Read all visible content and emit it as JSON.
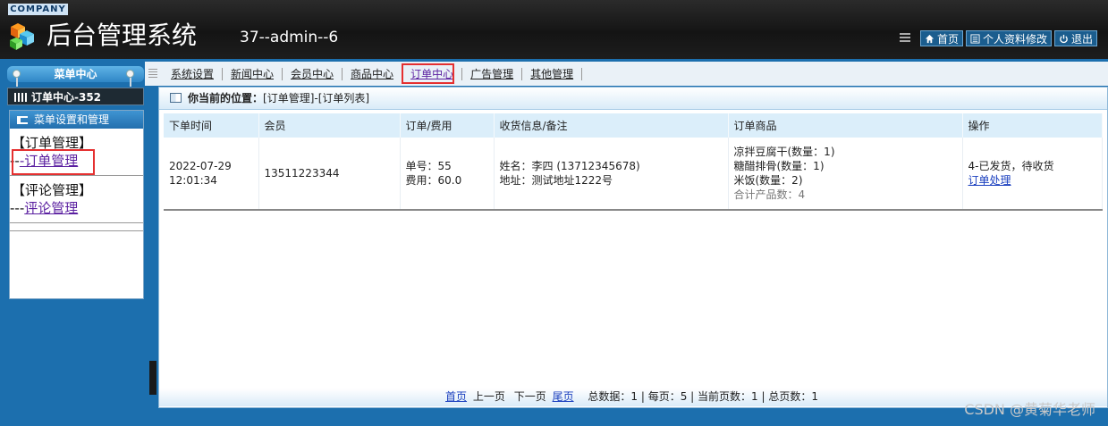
{
  "header": {
    "company": "COMPANY",
    "title": "后台管理系统",
    "user": "37--admin--6",
    "links": [
      {
        "label": "首页",
        "icon": "home-icon"
      },
      {
        "label": "个人资料修改",
        "icon": "profile-icon"
      },
      {
        "label": "退出",
        "icon": "power-icon"
      }
    ]
  },
  "sidebar": {
    "menu_center": "菜单中心",
    "current_center": "订单中心-352",
    "box_title": "菜单设置和管理",
    "groups": [
      {
        "title": "【订单管理】",
        "prefix": "--",
        "link": "-订单管理"
      },
      {
        "title": "【评论管理】",
        "prefix": "---",
        "link": "评论管理"
      }
    ]
  },
  "nav": {
    "items": [
      "系统设置",
      "新闻中心",
      "会员中心",
      "商品中心",
      "订单中心",
      "广告管理",
      "其他管理"
    ],
    "active": "订单中心"
  },
  "breadcrumb": {
    "label": "你当前的位置：",
    "path": "[订单管理]-[订单列表]"
  },
  "table": {
    "headers": [
      "下单时间",
      "会员",
      "订单/费用",
      "收货信息/备注",
      "订单商品",
      "操作"
    ],
    "rows": [
      {
        "date": "2022-07-29",
        "time": "12:01:34",
        "member": "13511223344",
        "order_no": "单号：55",
        "fee": "费用：60.0",
        "receiver_name": "姓名：李四 (13712345678)",
        "receiver_addr": "地址：测试地址1222号",
        "items": [
          "凉拌豆腐干(数量：1)",
          "糖醋排骨(数量：1)",
          "米饭(数量：2)"
        ],
        "items_total": "合计产品数：4",
        "status": "4-已发货，待收货",
        "action": "订单处理"
      }
    ]
  },
  "pager": {
    "first": "首页",
    "prev": "上一页",
    "next": "下一页",
    "last": "尾页",
    "summary": "总数据：1 | 每页：5 | 当前页数：1 | 总页数：1"
  },
  "watermark": "CSDN @黄菊华老师",
  "colors": {
    "header_bg": "#1a1a1a",
    "sidebar_bg": "#1c6fae",
    "highlight_border": "#e53030",
    "link": "#1a3fbf",
    "visited_link": "#5a1fa0"
  }
}
